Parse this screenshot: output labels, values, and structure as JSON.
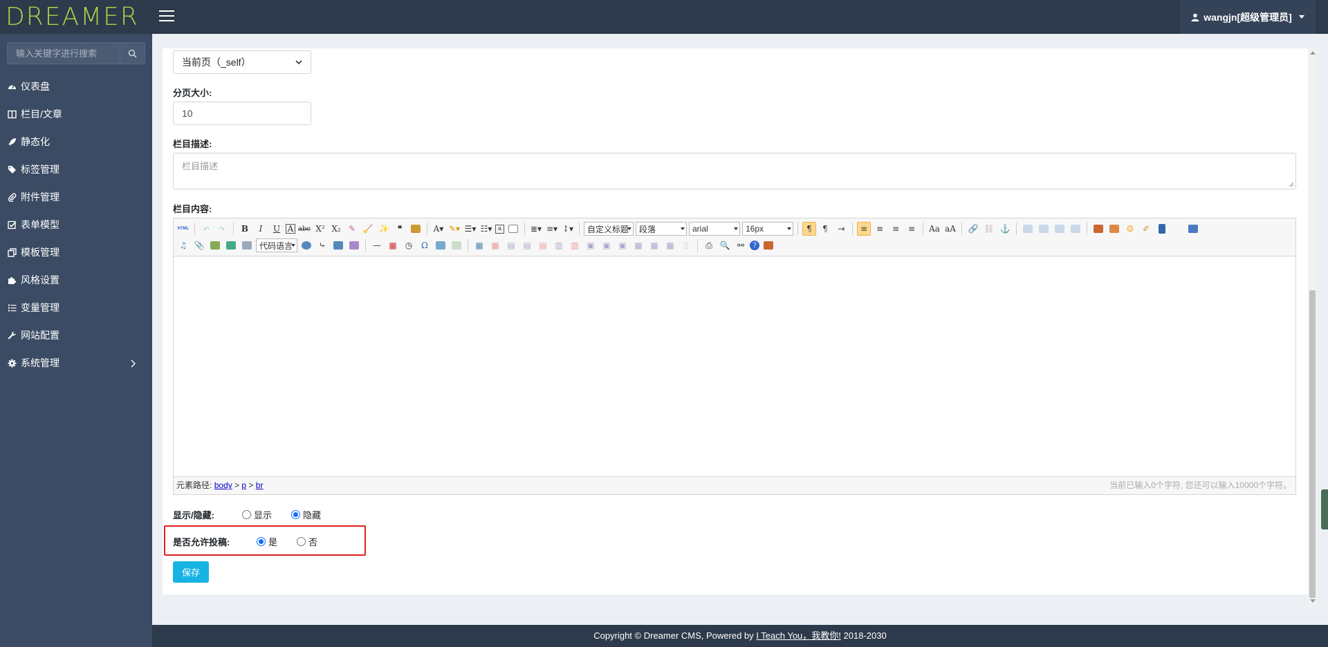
{
  "app": {
    "logo": "DREAMER",
    "user": "wangjn[超级管理员]"
  },
  "sidebar": {
    "search_placeholder": "输入关键字进行搜索",
    "items": [
      {
        "label": "仪表盘",
        "icon": "dashboard-icon"
      },
      {
        "label": "栏目/文章",
        "icon": "columns-icon"
      },
      {
        "label": "静态化",
        "icon": "rocket-icon"
      },
      {
        "label": "标签管理",
        "icon": "tags-icon"
      },
      {
        "label": "附件管理",
        "icon": "paperclip-icon"
      },
      {
        "label": "表单模型",
        "icon": "check-square-icon"
      },
      {
        "label": "模板管理",
        "icon": "copy-icon"
      },
      {
        "label": "风格设置",
        "icon": "puzzle-icon"
      },
      {
        "label": "变量管理",
        "icon": "list-icon"
      },
      {
        "label": "网站配置",
        "icon": "wrench-icon"
      },
      {
        "label": "系统管理",
        "icon": "gear-icon"
      }
    ]
  },
  "form": {
    "target_value": "当前页（_self）",
    "page_size_label": "分页大小:",
    "page_size_value": "10",
    "desc_label": "栏目描述:",
    "desc_placeholder": "栏目描述",
    "content_label": "栏目内容:",
    "editor": {
      "html_btn": "HTML",
      "custom_title": "自定义标题",
      "paragraph": "段落",
      "font": "arial",
      "font_size": "16px",
      "code_lang": "代码语言",
      "path_label": "元素路径:",
      "path": [
        "body",
        "p",
        "br"
      ],
      "count_text": "当前已输入0个字符, 您还可以输入10000个字符。"
    },
    "visibility_label": "显示/隐藏:",
    "visibility_options": [
      "显示",
      "隐藏"
    ],
    "visibility_selected": "隐藏",
    "submission_label": "是否允许投稿:",
    "submission_options": [
      "是",
      "否"
    ],
    "submission_selected": "是",
    "save_label": "保存"
  },
  "footer": {
    "prefix": "Copyright © Dreamer CMS, Powered by",
    "link": "I Teach You，我教你!",
    "suffix": "2018-2030"
  },
  "colors": {
    "topbar": "#2d3a4b",
    "sidebar": "#3a4b63",
    "logo": "#a9d34a",
    "save_button": "#17b3e3",
    "highlight": "#e02020"
  }
}
